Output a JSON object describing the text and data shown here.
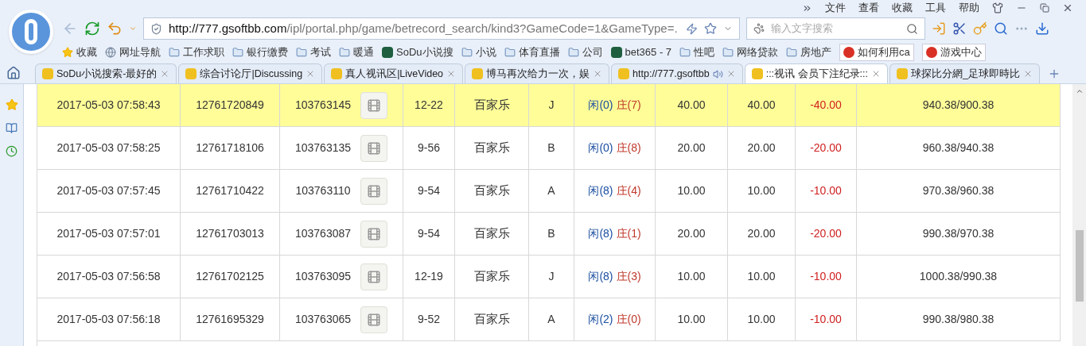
{
  "menu": [
    "文件",
    "查看",
    "收藏",
    "工具",
    "帮助"
  ],
  "address": {
    "host": "http://777.gsoftbb.com",
    "path": "/ipl/portal.php/game/betrecord_search/kind3?GameCode=1&GameType=."
  },
  "search": {
    "placeholder": "输入文字搜索"
  },
  "bookmarks": [
    {
      "kind": "star",
      "label": "收藏"
    },
    {
      "kind": "globe",
      "label": "网址导航"
    },
    {
      "kind": "folder",
      "label": "工作求职"
    },
    {
      "kind": "folder",
      "label": "银行缴费"
    },
    {
      "kind": "folder",
      "label": "考试"
    },
    {
      "kind": "folder",
      "label": "暖通"
    },
    {
      "kind": "site",
      "label": "SoDu小说搜"
    },
    {
      "kind": "folder",
      "label": "小说"
    },
    {
      "kind": "folder",
      "label": "体育直播"
    },
    {
      "kind": "folder",
      "label": "公司"
    },
    {
      "kind": "site",
      "label": "bet365 - 7"
    },
    {
      "kind": "folder",
      "label": "性吧"
    },
    {
      "kind": "folder",
      "label": "网络贷款"
    },
    {
      "kind": "folder",
      "label": "房地产"
    },
    {
      "kind": "button",
      "label": "如何利用ca"
    },
    {
      "kind": "button",
      "label": "游戏中心"
    }
  ],
  "tabs": [
    {
      "label": "SoDu小说搜索-最好的",
      "selected": false,
      "audio": false
    },
    {
      "label": "综合讨论厅|Discussing",
      "selected": false,
      "audio": false
    },
    {
      "label": "真人视讯区|LiveVideo",
      "selected": false,
      "audio": false
    },
    {
      "label": "博马再次给力一次，娱",
      "selected": false,
      "audio": false
    },
    {
      "label": "http://777.gsoftbb",
      "selected": false,
      "audio": true
    },
    {
      "label": ":::视讯 会员下注纪录:::",
      "selected": true,
      "audio": false
    },
    {
      "label": "球探比分網_足球即時比",
      "selected": false,
      "audio": false
    }
  ],
  "rows": [
    {
      "time": "2017-05-03 07:58:43",
      "bet_no": "12761720849",
      "game_no": "103763145",
      "round": "12-22",
      "game": "百家乐",
      "table": "J",
      "player": "闲(0)",
      "banker": "庄(7)",
      "bet": "40.00",
      "valid": "40.00",
      "result": "-40.00",
      "balance": "940.38/900.38",
      "selected": true
    },
    {
      "time": "2017-05-03 07:58:25",
      "bet_no": "12761718106",
      "game_no": "103763135",
      "round": "9-56",
      "game": "百家乐",
      "table": "B",
      "player": "闲(0)",
      "banker": "庄(8)",
      "bet": "20.00",
      "valid": "20.00",
      "result": "-20.00",
      "balance": "960.38/940.38",
      "selected": false
    },
    {
      "time": "2017-05-03 07:57:45",
      "bet_no": "12761710422",
      "game_no": "103763110",
      "round": "9-54",
      "game": "百家乐",
      "table": "A",
      "player": "闲(8)",
      "banker": "庄(4)",
      "bet": "10.00",
      "valid": "10.00",
      "result": "-10.00",
      "balance": "970.38/960.38",
      "selected": false
    },
    {
      "time": "2017-05-03 07:57:01",
      "bet_no": "12761703013",
      "game_no": "103763087",
      "round": "9-54",
      "game": "百家乐",
      "table": "B",
      "player": "闲(8)",
      "banker": "庄(1)",
      "bet": "20.00",
      "valid": "20.00",
      "result": "-20.00",
      "balance": "990.38/970.38",
      "selected": false
    },
    {
      "time": "2017-05-03 07:56:58",
      "bet_no": "12761702125",
      "game_no": "103763095",
      "round": "12-19",
      "game": "百家乐",
      "table": "J",
      "player": "闲(8)",
      "banker": "庄(3)",
      "bet": "10.00",
      "valid": "10.00",
      "result": "-10.00",
      "balance": "1000.38/990.38",
      "selected": false
    },
    {
      "time": "2017-05-03 07:56:18",
      "bet_no": "12761695329",
      "game_no": "103763065",
      "round": "9-52",
      "game": "百家乐",
      "table": "A",
      "player": "闲(2)",
      "banker": "庄(0)",
      "bet": "10.00",
      "valid": "10.00",
      "result": "-10.00",
      "balance": "990.38/980.38",
      "selected": false
    }
  ]
}
